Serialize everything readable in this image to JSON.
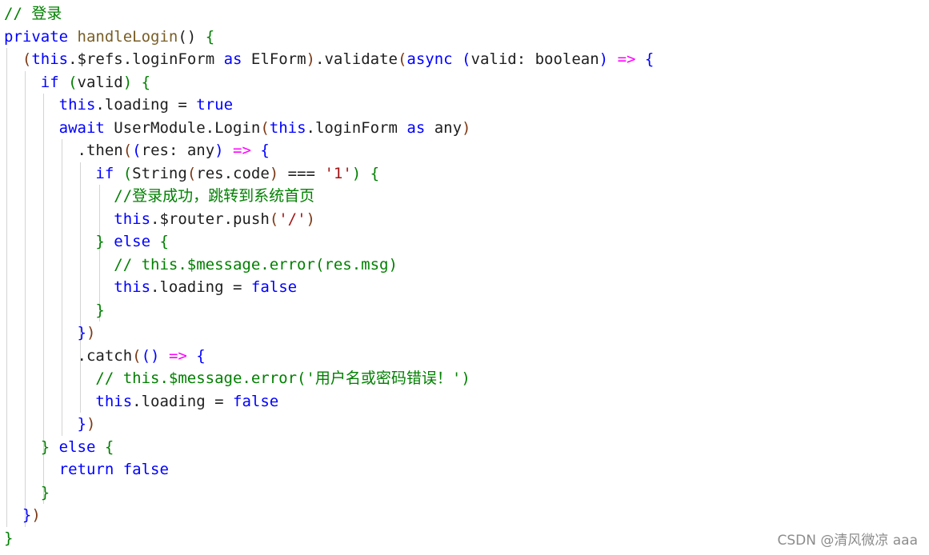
{
  "editor": {
    "lines": [
      {
        "tokens": [
          {
            "t": "// 登录",
            "c": "cm"
          }
        ]
      },
      {
        "tokens": [
          {
            "t": "private ",
            "c": "kw"
          },
          {
            "t": "handleLogin",
            "c": "fn"
          },
          {
            "t": "() ",
            "c": "pl"
          },
          {
            "t": "{",
            "c": "br1"
          }
        ]
      },
      {
        "tokens": [
          {
            "t": "  ",
            "c": "pl"
          },
          {
            "t": "(",
            "c": "br2"
          },
          {
            "t": "this",
            "c": "kw"
          },
          {
            "t": ".$refs.loginForm ",
            "c": "pl"
          },
          {
            "t": "as ",
            "c": "kw"
          },
          {
            "t": "ElForm",
            "c": "pl"
          },
          {
            "t": ")",
            "c": "br2"
          },
          {
            "t": ".validate",
            "c": "pl"
          },
          {
            "t": "(",
            "c": "br2"
          },
          {
            "t": "async ",
            "c": "kw"
          },
          {
            "t": "(",
            "c": "br3"
          },
          {
            "t": "valid: boolean",
            "c": "pl"
          },
          {
            "t": ")",
            "c": "br3"
          },
          {
            "t": " ",
            "c": "pl"
          },
          {
            "t": "=>",
            "c": "arrow"
          },
          {
            "t": " ",
            "c": "pl"
          },
          {
            "t": "{",
            "c": "br3"
          }
        ]
      },
      {
        "tokens": [
          {
            "t": "    ",
            "c": "pl"
          },
          {
            "t": "if ",
            "c": "kw"
          },
          {
            "t": "(",
            "c": "br1"
          },
          {
            "t": "valid",
            "c": "pl"
          },
          {
            "t": ")",
            "c": "br1"
          },
          {
            "t": " ",
            "c": "pl"
          },
          {
            "t": "{",
            "c": "br1"
          }
        ]
      },
      {
        "tokens": [
          {
            "t": "      ",
            "c": "pl"
          },
          {
            "t": "this",
            "c": "kw"
          },
          {
            "t": ".loading = ",
            "c": "pl"
          },
          {
            "t": "true",
            "c": "kw"
          }
        ]
      },
      {
        "tokens": [
          {
            "t": "      ",
            "c": "pl"
          },
          {
            "t": "await ",
            "c": "kw"
          },
          {
            "t": "UserModule.Login",
            "c": "pl"
          },
          {
            "t": "(",
            "c": "br2"
          },
          {
            "t": "this",
            "c": "kw"
          },
          {
            "t": ".loginForm ",
            "c": "pl"
          },
          {
            "t": "as ",
            "c": "kw"
          },
          {
            "t": "any",
            "c": "pl"
          },
          {
            "t": ")",
            "c": "br2"
          }
        ]
      },
      {
        "tokens": [
          {
            "t": "        .then",
            "c": "pl"
          },
          {
            "t": "(",
            "c": "br2"
          },
          {
            "t": "(",
            "c": "br3"
          },
          {
            "t": "res: any",
            "c": "pl"
          },
          {
            "t": ")",
            "c": "br3"
          },
          {
            "t": " ",
            "c": "pl"
          },
          {
            "t": "=>",
            "c": "arrow"
          },
          {
            "t": " ",
            "c": "pl"
          },
          {
            "t": "{",
            "c": "br3"
          }
        ]
      },
      {
        "tokens": [
          {
            "t": "          ",
            "c": "pl"
          },
          {
            "t": "if ",
            "c": "kw"
          },
          {
            "t": "(",
            "c": "br1"
          },
          {
            "t": "String",
            "c": "pl"
          },
          {
            "t": "(",
            "c": "br2"
          },
          {
            "t": "res.code",
            "c": "pl"
          },
          {
            "t": ")",
            "c": "br2"
          },
          {
            "t": " === ",
            "c": "pl"
          },
          {
            "t": "'1'",
            "c": "str"
          },
          {
            "t": ")",
            "c": "br1"
          },
          {
            "t": " ",
            "c": "pl"
          },
          {
            "t": "{",
            "c": "br1"
          }
        ]
      },
      {
        "tokens": [
          {
            "t": "            ",
            "c": "pl"
          },
          {
            "t": "//登录成功，跳转到系统首页",
            "c": "cm"
          }
        ]
      },
      {
        "tokens": [
          {
            "t": "            ",
            "c": "pl"
          },
          {
            "t": "this",
            "c": "kw"
          },
          {
            "t": ".$router.push",
            "c": "pl"
          },
          {
            "t": "(",
            "c": "br2"
          },
          {
            "t": "'/'",
            "c": "str"
          },
          {
            "t": ")",
            "c": "br2"
          }
        ]
      },
      {
        "tokens": [
          {
            "t": "          ",
            "c": "pl"
          },
          {
            "t": "}",
            "c": "br1"
          },
          {
            "t": " ",
            "c": "pl"
          },
          {
            "t": "else ",
            "c": "kw"
          },
          {
            "t": "{",
            "c": "br1"
          }
        ]
      },
      {
        "tokens": [
          {
            "t": "            ",
            "c": "pl"
          },
          {
            "t": "// this.$message.error(res.msg)",
            "c": "cm"
          }
        ]
      },
      {
        "tokens": [
          {
            "t": "            ",
            "c": "pl"
          },
          {
            "t": "this",
            "c": "kw"
          },
          {
            "t": ".loading = ",
            "c": "pl"
          },
          {
            "t": "false",
            "c": "kw"
          }
        ]
      },
      {
        "tokens": [
          {
            "t": "          ",
            "c": "pl"
          },
          {
            "t": "}",
            "c": "br1"
          }
        ]
      },
      {
        "tokens": [
          {
            "t": "        ",
            "c": "pl"
          },
          {
            "t": "}",
            "c": "br3"
          },
          {
            "t": ")",
            "c": "br2"
          }
        ]
      },
      {
        "tokens": [
          {
            "t": "        .catch",
            "c": "pl"
          },
          {
            "t": "(",
            "c": "br2"
          },
          {
            "t": "()",
            "c": "br3"
          },
          {
            "t": " ",
            "c": "pl"
          },
          {
            "t": "=>",
            "c": "arrow"
          },
          {
            "t": " ",
            "c": "pl"
          },
          {
            "t": "{",
            "c": "br3"
          }
        ]
      },
      {
        "tokens": [
          {
            "t": "          ",
            "c": "pl"
          },
          {
            "t": "// this.$message.error('用户名或密码错误！')",
            "c": "cm"
          }
        ]
      },
      {
        "tokens": [
          {
            "t": "          ",
            "c": "pl"
          },
          {
            "t": "this",
            "c": "kw"
          },
          {
            "t": ".loading = ",
            "c": "pl"
          },
          {
            "t": "false",
            "c": "kw"
          }
        ]
      },
      {
        "tokens": [
          {
            "t": "        ",
            "c": "pl"
          },
          {
            "t": "}",
            "c": "br3"
          },
          {
            "t": ")",
            "c": "br2"
          }
        ]
      },
      {
        "tokens": [
          {
            "t": "    ",
            "c": "pl"
          },
          {
            "t": "}",
            "c": "br1"
          },
          {
            "t": " ",
            "c": "pl"
          },
          {
            "t": "else ",
            "c": "kw"
          },
          {
            "t": "{",
            "c": "br1"
          }
        ]
      },
      {
        "tokens": [
          {
            "t": "      ",
            "c": "pl"
          },
          {
            "t": "return ",
            "c": "kw"
          },
          {
            "t": "false",
            "c": "kw"
          }
        ]
      },
      {
        "tokens": [
          {
            "t": "    ",
            "c": "pl"
          },
          {
            "t": "}",
            "c": "br1"
          }
        ]
      },
      {
        "tokens": [
          {
            "t": "  ",
            "c": "pl"
          },
          {
            "t": "}",
            "c": "br3"
          },
          {
            "t": ")",
            "c": "br2"
          }
        ]
      },
      {
        "tokens": [
          {
            "t": "}",
            "c": "br1"
          }
        ]
      }
    ]
  },
  "watermark": {
    "text": "CSDN @清风微凉 aaa"
  },
  "colors": {
    "background": "#ffffff",
    "keyword": "#0000ff",
    "comment": "#008000",
    "string": "#a31515",
    "function": "#795e26",
    "arrow": "#ff00ff",
    "bracket_level1": "#008000",
    "bracket_level2": "#7b3814",
    "bracket_level3": "#0000ff",
    "indent_guide": "#d4d4d4"
  }
}
